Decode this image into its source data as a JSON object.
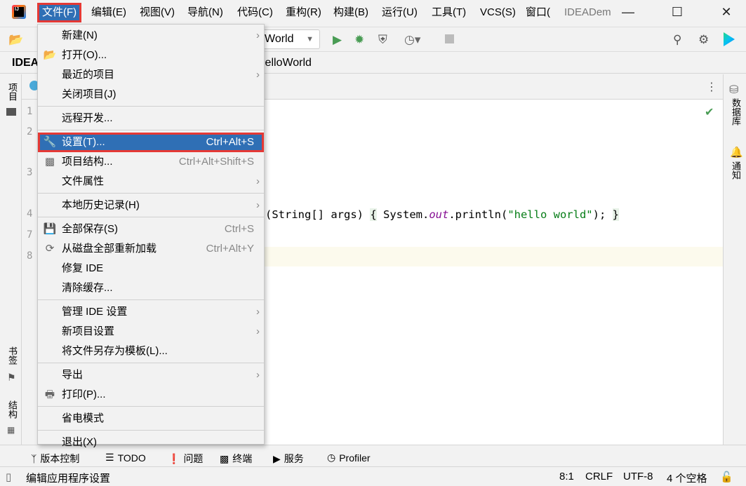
{
  "menubar": {
    "items": [
      "文件(F)",
      "编辑(E)",
      "视图(V)",
      "导航(N)",
      "代码(C)",
      "重构(R)",
      "构建(B)",
      "运行(U)",
      "工具(T)",
      "VCS(S)",
      "窗口(",
      "IDEADem"
    ]
  },
  "toolbar": {
    "run_config": "World"
  },
  "breadcrumb": {
    "project": "IDEA",
    "file": "HelloWorld"
  },
  "left_strip": {
    "project": "项目",
    "bookmarks": "书签",
    "structure": "结构"
  },
  "right_strip": {
    "database": "数据库",
    "notifications": "通知"
  },
  "editor": {
    "line_numbers": [
      "1",
      "2",
      "3",
      "4",
      "7",
      "8"
    ],
    "code_line4": {
      "params": "(String[] args) ",
      "brace_open": "{",
      "sys": " System.",
      "out": "out",
      "println": ".println(",
      "str": "\"hello world\"",
      "end": "); ",
      "brace_close": "}"
    }
  },
  "file_menu": {
    "items": [
      {
        "label": "新建(N)",
        "submenu": true
      },
      {
        "label": "打开(O)...",
        "icon": "folder-open-icon"
      },
      {
        "label": "最近的项目",
        "submenu": true
      },
      {
        "label": "关闭项目(J)"
      },
      {
        "label": "远程开发..."
      },
      {
        "label": "设置(T)...",
        "shortcut": "Ctrl+Alt+S",
        "icon": "wrench-icon",
        "selected": true
      },
      {
        "label": "项目结构...",
        "shortcut": "Ctrl+Alt+Shift+S",
        "icon": "project-structure-icon"
      },
      {
        "label": "文件属性",
        "submenu": true
      },
      {
        "label": "本地历史记录(H)",
        "submenu": true
      },
      {
        "label": "全部保存(S)",
        "shortcut": "Ctrl+S",
        "icon": "save-icon"
      },
      {
        "label": "从磁盘全部重新加载",
        "shortcut": "Ctrl+Alt+Y",
        "icon": "reload-icon"
      },
      {
        "label": "修复 IDE"
      },
      {
        "label": "清除缓存..."
      },
      {
        "label": "管理 IDE 设置",
        "submenu": true
      },
      {
        "label": "新项目设置",
        "submenu": true
      },
      {
        "label": "将文件另存为模板(L)..."
      },
      {
        "label": "导出",
        "submenu": true
      },
      {
        "label": "打印(P)...",
        "icon": "print-icon"
      },
      {
        "label": "省电模式"
      },
      {
        "label": "退出(X)"
      }
    ]
  },
  "bottom_tools": [
    "版本控制",
    "TODO",
    "问题",
    "终端",
    "服务",
    "Profiler"
  ],
  "status": {
    "message": "编辑应用程序设置",
    "position": "8:1",
    "line_ending": "CRLF",
    "encoding": "UTF-8",
    "indent": "4 个空格"
  },
  "colors": {
    "accent": "#2f6fb5",
    "highlight_border": "#e53935",
    "run_green": "#499c54"
  }
}
